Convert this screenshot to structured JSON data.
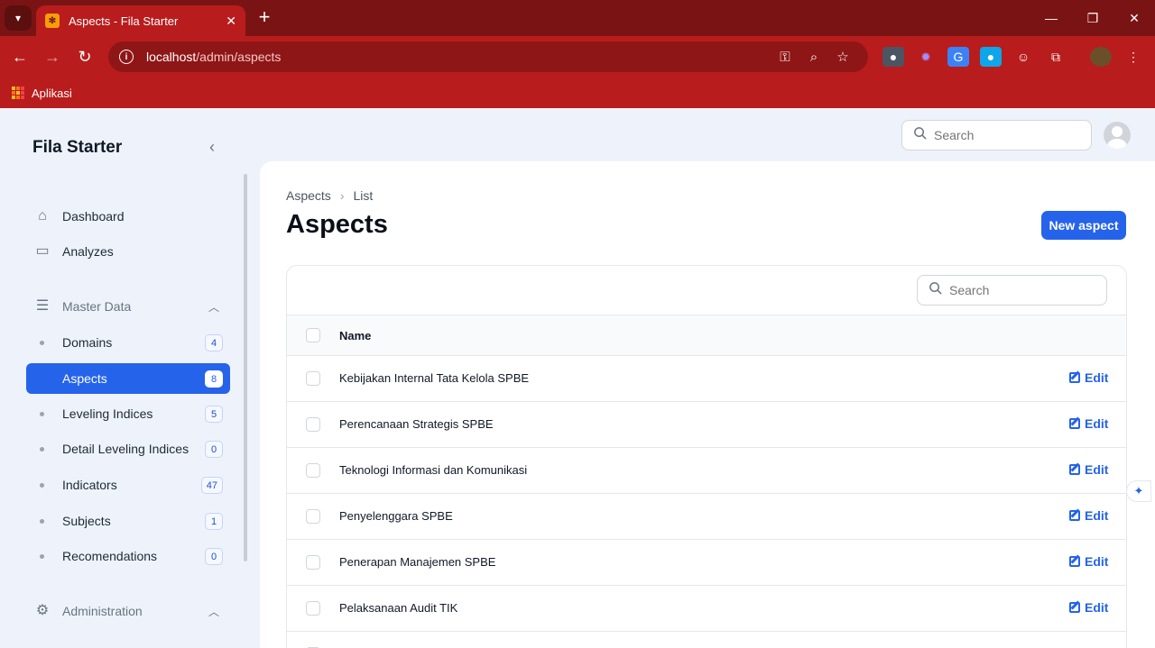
{
  "browser": {
    "tab_title": "Aspects - Fila Starter",
    "url_host": "localhost",
    "url_path": "/admin/aspects",
    "bookmark_label": "Aplikasi"
  },
  "app": {
    "brand": "Fila Starter",
    "top_search_placeholder": "Search"
  },
  "sidebar": {
    "dashboard": "Dashboard",
    "analyzes": "Analyzes",
    "group_master": "Master Data",
    "items": [
      {
        "label": "Domains",
        "count": "4"
      },
      {
        "label": "Aspects",
        "count": "8"
      },
      {
        "label": "Leveling Indices",
        "count": "5"
      },
      {
        "label": "Detail Leveling Indices",
        "count": "0"
      },
      {
        "label": "Indicators",
        "count": "47"
      },
      {
        "label": "Subjects",
        "count": "1"
      },
      {
        "label": "Recomendations",
        "count": "0"
      }
    ],
    "group_admin": "Administration"
  },
  "main": {
    "breadcrumb": [
      "Aspects",
      "List"
    ],
    "title": "Aspects",
    "new_button": "New aspect",
    "table_search_placeholder": "Search",
    "column_name": "Name",
    "edit_label": "Edit",
    "rows": [
      "Kebijakan Internal Tata Kelola SPBE",
      "Perencanaan Strategis SPBE",
      "Teknologi Informasi dan Komunikasi",
      "Penyelenggara SPBE",
      "Penerapan Manajemen SPBE",
      "Pelaksanaan Audit TIK"
    ]
  },
  "colors": {
    "browser_frame": "#b91c1c",
    "tab_strip": "#7a1414",
    "primary": "#2563eb",
    "app_background": "#eef3fb"
  }
}
